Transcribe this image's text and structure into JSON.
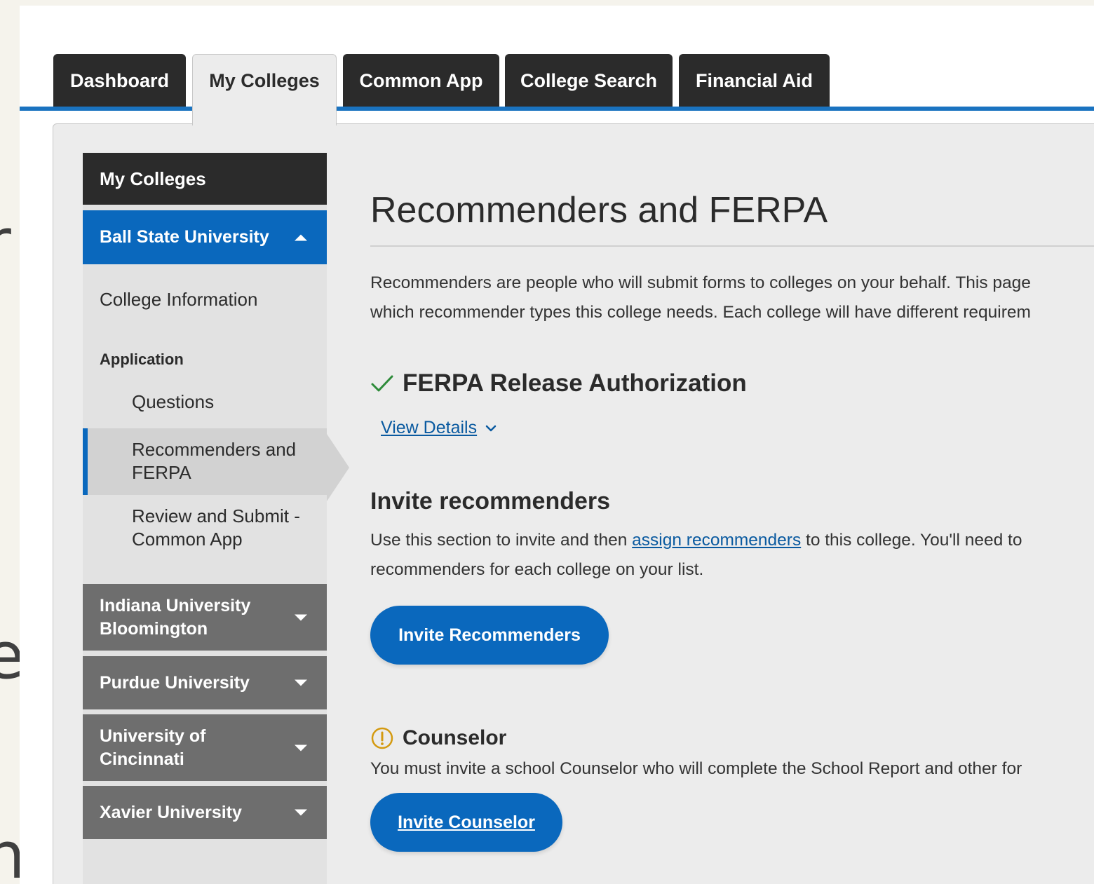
{
  "tabs": [
    "Dashboard",
    "My Colleges",
    "Common App",
    "College Search",
    "Financial Aid"
  ],
  "sidebar": {
    "header": "My Colleges",
    "open_college": "Ball State University",
    "items": {
      "college_info": "College Information",
      "application": "Application",
      "questions": "Questions",
      "recommenders": "Recommenders and FERPA",
      "review_submit": "Review and Submit - Common App"
    },
    "colleges": [
      "Indiana University Bloomington",
      "Purdue University",
      "University of Cincinnati",
      "Xavier University"
    ]
  },
  "main": {
    "title": "Recommenders and FERPA",
    "intro_line1": "Recommenders are people who will submit forms to colleges on your behalf. This page",
    "intro_line2": "which recommender types this college needs. Each college will have different requirem",
    "ferpa_title": "FERPA Release Authorization",
    "view_details": "View Details",
    "invite_heading": "Invite recommenders",
    "invite_pre": "Use this section to invite and then ",
    "invite_link": "assign recommenders",
    "invite_post": " to this college. You'll need to",
    "invite_line2": "recommenders for each college on your list.",
    "invite_button": "Invite Recommenders",
    "counselor_title": "Counselor",
    "counselor_desc": "You must invite a school Counselor who will complete the School Report and other for",
    "counselor_button": "Invite Counselor"
  },
  "edge_glyphs": [
    "r",
    "e",
    "n"
  ],
  "colors": {
    "tab_dark": "#2b2b2b",
    "accent_blue": "#0a68bd",
    "success_green": "#2e8b3a",
    "warning_amber": "#d49a10"
  }
}
